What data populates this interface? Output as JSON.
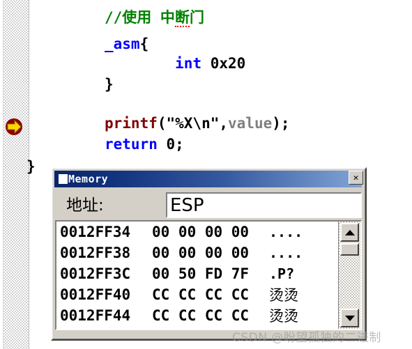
{
  "editor": {
    "code_lines": [
      {
        "id": "comment",
        "text": "//使用 中断门",
        "color": "#008000"
      },
      {
        "id": "asm",
        "text": "_asm{",
        "color": "#0000ff"
      },
      {
        "id": "int",
        "text": "int 0x20",
        "color": "#0000ff"
      },
      {
        "id": "brace1",
        "text": "}",
        "color": "#000000"
      },
      {
        "id": "printf",
        "text": "printf(\"%X\\n\",value);",
        "color": "#800000"
      },
      {
        "id": "return",
        "text": "return 0;",
        "color": "#0000ff"
      },
      {
        "id": "brace2",
        "text": "}",
        "color": "#000000"
      }
    ],
    "line_comment": "//使用 中断门",
    "line_comment_a": "//使用 中",
    "line_comment_b": "断",
    "line_comment_c": "门",
    "line_asm_kw": "_asm",
    "line_asm_brace": "{",
    "line_int_indent": "        ",
    "line_int_kw": "int",
    "line_int_operand": " 0x20",
    "line_brace1": "}",
    "line_printf_fn": "printf",
    "line_printf_args_open": "(\"%X\\n\",",
    "line_printf_var": "value",
    "line_printf_close": ");",
    "line_return_kw": "return",
    "line_return_val": " 0;",
    "line_brace2": "}",
    "exec_arrow_icon": "current-statement-arrow-icon"
  },
  "memory_window": {
    "title": "Memory",
    "title_icon": "window-menu-icon",
    "close_label": "✕",
    "close_icon": "close-icon",
    "address_label": "地址:",
    "address_value": "ESP",
    "address_placeholder": "",
    "columns": [
      "address",
      "bytes",
      "ascii"
    ],
    "rows": [
      {
        "address": "0012FF34",
        "bytes": "00 00 00 00",
        "ascii": "....",
        "ascii_cjk": false
      },
      {
        "address": "0012FF38",
        "bytes": "00 00 00 00",
        "ascii": "....",
        "ascii_cjk": false
      },
      {
        "address": "0012FF3C",
        "bytes": "00 50 FD 7F",
        "ascii": ".P?",
        "ascii_cjk": false
      },
      {
        "address": "0012FF40",
        "bytes": "CC CC CC CC",
        "ascii": "烫烫",
        "ascii_cjk": true
      },
      {
        "address": "0012FF44",
        "bytes": "CC CC CC CC",
        "ascii": "烫烫",
        "ascii_cjk": true
      }
    ],
    "scrollbar": {
      "up_icon": "scroll-up-arrow-icon",
      "down_icon": "scroll-down-arrow-icon",
      "thumb_name": "scrollbar-thumb"
    }
  },
  "watermark": {
    "text": "CSDN @盼望孤独的二进制"
  },
  "colors": {
    "keyword": "#0000ff",
    "comment": "#008000",
    "function": "#800000",
    "variable": "#808080",
    "titlebar_start": "#0a246a",
    "titlebar_end": "#81a4d6",
    "window_face": "#d4d0c8"
  }
}
